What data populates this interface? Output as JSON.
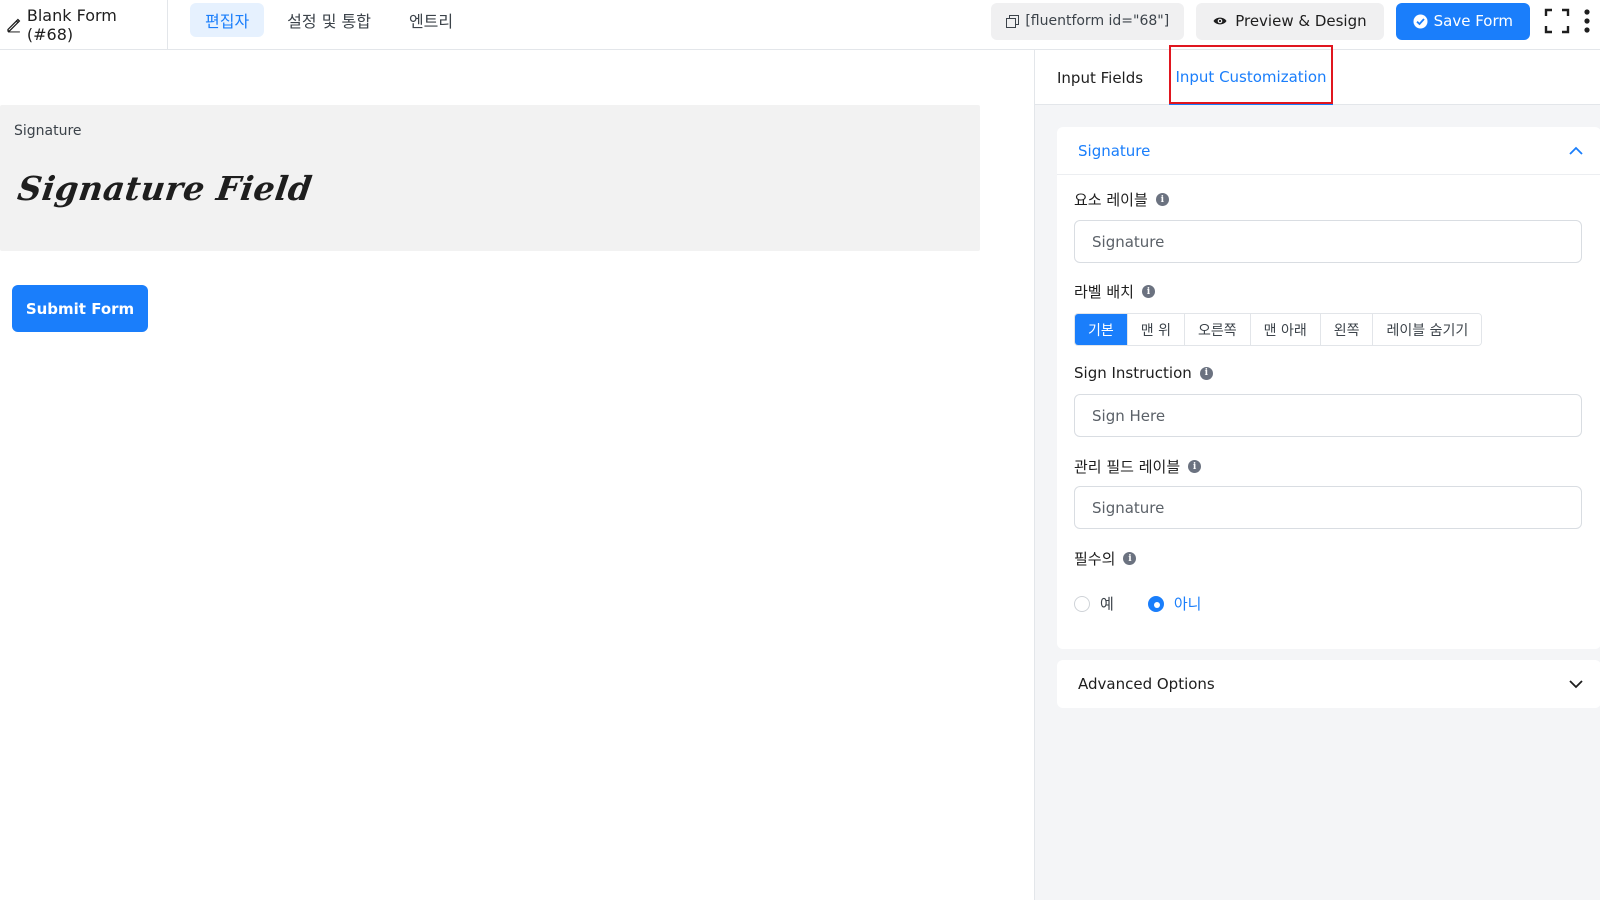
{
  "header": {
    "form_title": "Blank Form (#68)",
    "nav": [
      {
        "label": "편집자",
        "active": true
      },
      {
        "label": "설정 및 통합",
        "active": false
      },
      {
        "label": "엔트리",
        "active": false
      }
    ],
    "shortcode": "[fluentform id=\"68\"]",
    "preview_label": "Preview & Design",
    "save_label": "Save Form"
  },
  "canvas": {
    "signature_label": "Signature",
    "signature_placeholder": "Signature Field",
    "submit_label": "Submit Form"
  },
  "panel": {
    "tabs": [
      {
        "label": "Input Fields",
        "active": false
      },
      {
        "label": "Input Customization",
        "active": true
      }
    ],
    "section_title": "Signature",
    "element_label": {
      "label": "요소 레이블",
      "value": "Signature"
    },
    "label_placement": {
      "label": "라벨 배치",
      "options": [
        "기본",
        "맨 위",
        "오른쪽",
        "맨 아래",
        "왼쪽",
        "레이블 숨기기"
      ],
      "selected": "기본"
    },
    "sign_instruction": {
      "label": "Sign Instruction",
      "value": "Sign Here"
    },
    "admin_field_label": {
      "label": "관리 필드 레이블",
      "value": "Signature"
    },
    "required": {
      "label": "필수의",
      "options": [
        "예",
        "아니"
      ],
      "selected": "아니"
    },
    "advanced_title": "Advanced Options"
  },
  "colors": {
    "accent": "#1a7efb",
    "highlight": "#e0161f",
    "panel_bg": "#f4f5f7",
    "field_bg": "#f2f2f2"
  }
}
